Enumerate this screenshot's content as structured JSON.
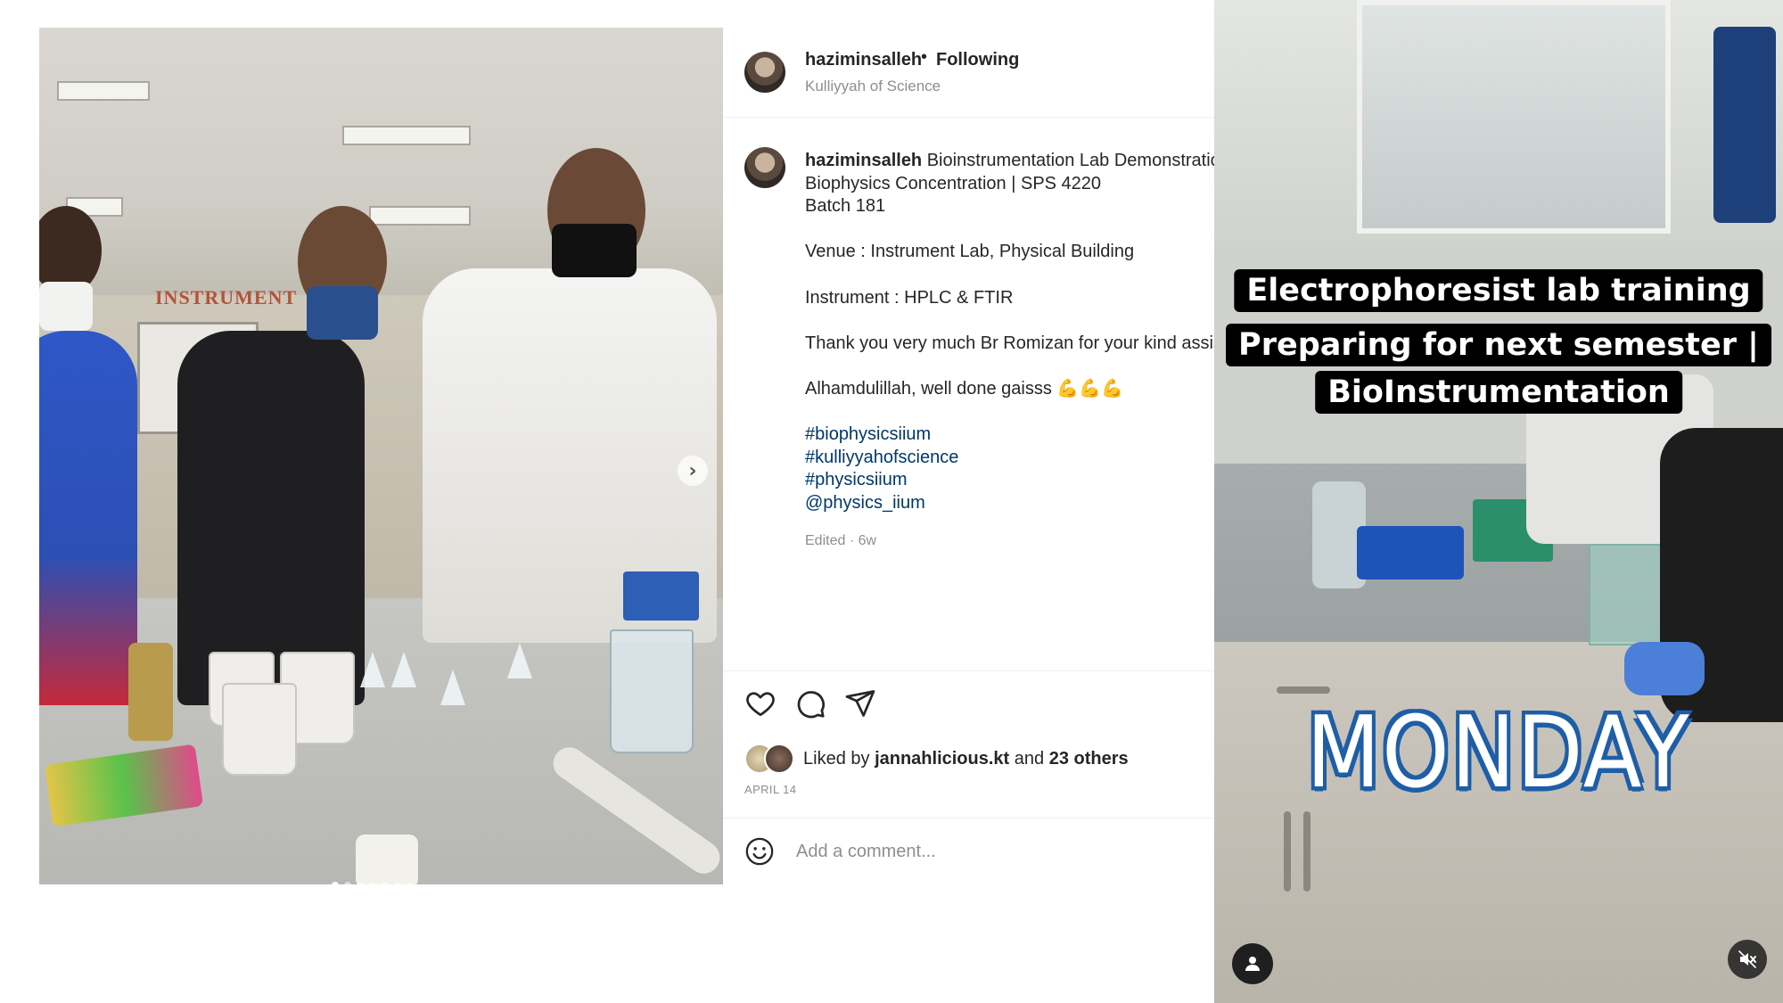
{
  "post": {
    "username": "haziminsalleh",
    "separator": "•",
    "follow_status": "Following",
    "location": "Kulliyyah of Science",
    "photo_sign": "INSTRUMENT",
    "carousel": {
      "slide_count": 7,
      "active_index": 0
    }
  },
  "caption": {
    "username": "haziminsalleh",
    "line1": "Bioinstrumentation Lab Demonstration",
    "line2": "Biophysics Concentration | SPS 4220",
    "line3": "Batch 181",
    "venue": "Venue : Instrument Lab, Physical Building",
    "instrument": "Instrument : HPLC & FTIR",
    "thanks": "Thank you very much Br Romizan for your kind assistance",
    "closing": "Alhamdulillah, well done gaisss 💪💪💪",
    "hashtags": [
      "#biophysicsiium",
      "#kulliyyahofscience",
      "#physicsiium",
      "@physics_iium"
    ],
    "edited": "Edited · 6w"
  },
  "actions": {
    "like_icon": "heart-icon",
    "comment_icon": "comment-icon",
    "share_icon": "paper-plane-icon"
  },
  "likes": {
    "prefix": "Liked by",
    "user": "jannahlicious.kt",
    "connector": "and",
    "others": "23 others"
  },
  "date": "APRIL 14",
  "comment": {
    "placeholder": "Add a comment...",
    "emoji_icon": "smiley-icon"
  },
  "reel": {
    "caption_lines": [
      "Electrophoresist lab training",
      "Preparing for next semester |",
      "BioInstrumentation"
    ],
    "day_label": "MONDAY",
    "user_icon": "user-icon",
    "mute_icon": "speaker-muted-icon"
  },
  "colors": {
    "link": "#00376b",
    "secondary_text": "#8e8e8e",
    "day_outline": "#1e5ea8"
  }
}
